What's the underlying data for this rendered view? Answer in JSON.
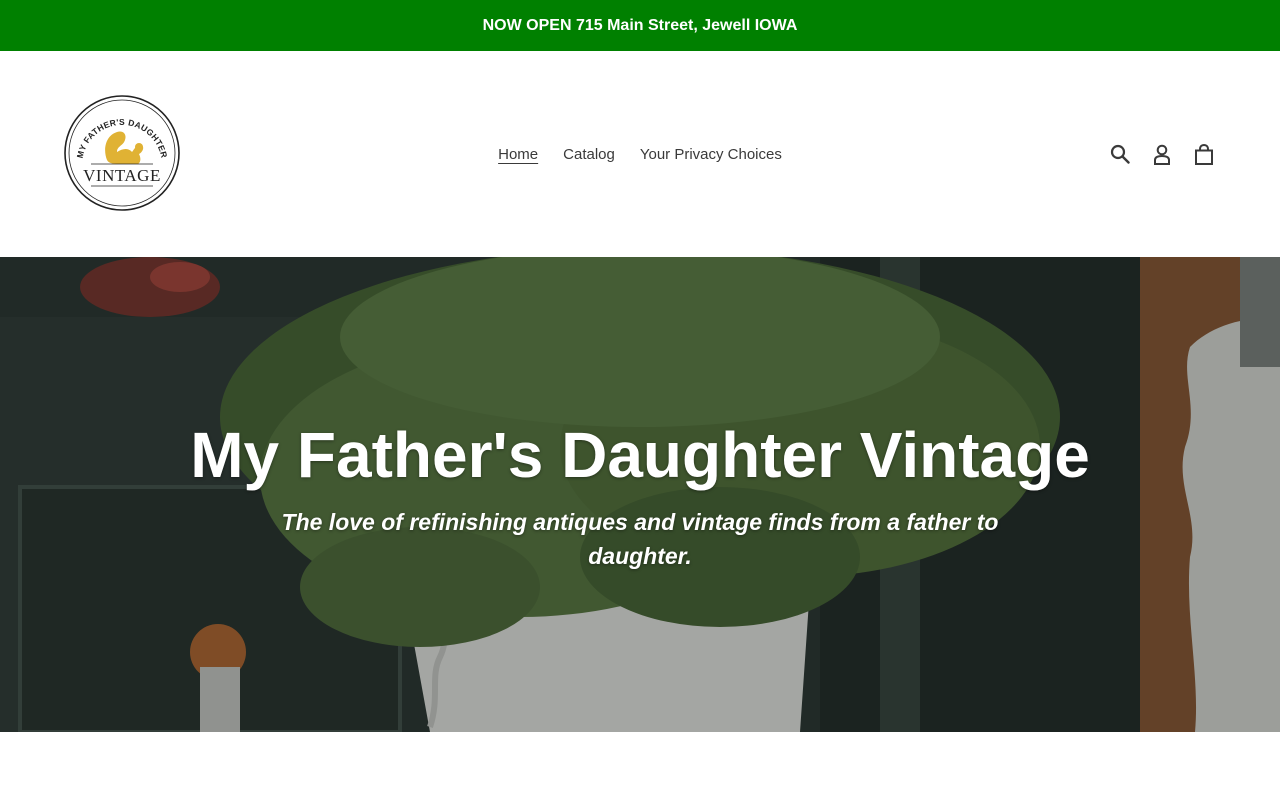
{
  "announcement": {
    "text": "NOW OPEN 715 Main Street, Jewell IOWA",
    "background": "#008000"
  },
  "header": {
    "logo": {
      "top_text": "MY FATHER'S DAUGHTER",
      "bottom_text": "VINTAGE",
      "accent": "#e0b234"
    },
    "nav": [
      {
        "label": "Home",
        "active": true
      },
      {
        "label": "Catalog",
        "active": false
      },
      {
        "label": "Your Privacy Choices",
        "active": false
      }
    ],
    "icons": [
      "search-icon",
      "account-icon",
      "cart-icon"
    ]
  },
  "hero": {
    "title": "My Father's Daughter Vintage",
    "subtitle": "The love of refinishing antiques and vintage finds from a father to daughter."
  }
}
